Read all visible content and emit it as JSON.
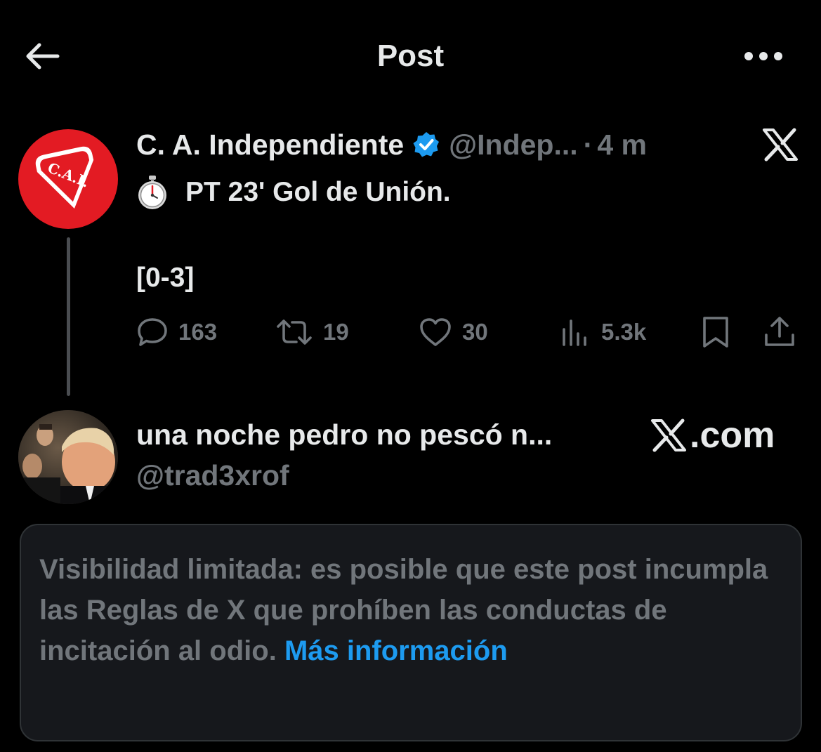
{
  "header": {
    "title": "Post"
  },
  "post": {
    "author_name": "C. A. Independiente",
    "handle": "@Indep...",
    "separator": "·",
    "time": "4 m",
    "avatar_text": "C.A.I.",
    "text_line1": "PT 23' Gol de Unión.",
    "text_line2": "[0-3]",
    "stats": {
      "replies": "163",
      "reposts": "19",
      "likes": "30",
      "views": "5.3k"
    }
  },
  "quoted": {
    "name": "una noche pedro no pescó n...",
    "handle": "@trad3xrof",
    "source_label": ".com"
  },
  "notice": {
    "text": "Visibilidad limitada: es posible que este post incumpla las Reglas de X que prohíben las conductas de incitación al odio. ",
    "link_text": "Más información"
  },
  "colors": {
    "background": "#000000",
    "text_primary": "#e7e9ea",
    "text_secondary": "#71767b",
    "accent_blue": "#1d9bf0",
    "verified_badge": "#1d9bf0",
    "club_red": "#e31b23",
    "notice_bg": "#16181c",
    "thread_line": "#4a4d51"
  },
  "icons": {
    "back": "arrow-left-icon",
    "more": "more-horizontal-icon",
    "verified": "verified-badge-icon",
    "x_logo": "x-logo-icon",
    "stopwatch": "stopwatch-icon",
    "reply": "reply-icon",
    "repost": "repost-icon",
    "like": "heart-icon",
    "views": "views-icon",
    "bookmark": "bookmark-icon",
    "share": "share-icon"
  }
}
